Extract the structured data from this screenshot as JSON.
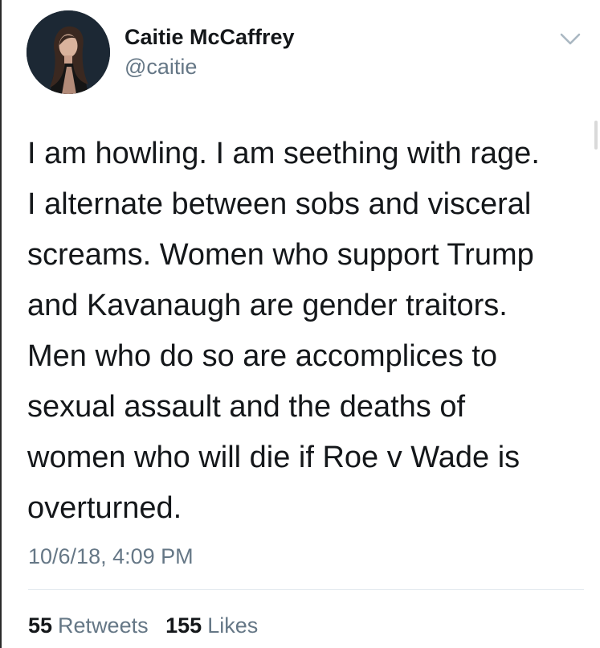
{
  "tweet": {
    "author": {
      "display_name": "Caitie McCaffrey",
      "handle": "@caitie",
      "avatar": "profile-photo"
    },
    "menu_icon": "chevron-down-icon",
    "text_lines": [
      "I am howling.  I am seething with rage.",
      "I alternate between sobs and visceral",
      "screams.  Women who support Trump",
      "and Kavanaugh are gender traitors.",
      "Men who do so are accomplices to",
      "sexual assault and the deaths of",
      "women who will die if Roe v Wade is",
      "overturned."
    ],
    "timestamp": "10/6/18, 4:09 PM",
    "stats": {
      "retweets_count": "55",
      "retweets_label": "Retweets",
      "likes_count": "155",
      "likes_label": "Likes"
    }
  },
  "colors": {
    "text_primary": "#14171a",
    "text_secondary": "#657786",
    "divider": "#e1e8ed",
    "background": "#ffffff"
  }
}
